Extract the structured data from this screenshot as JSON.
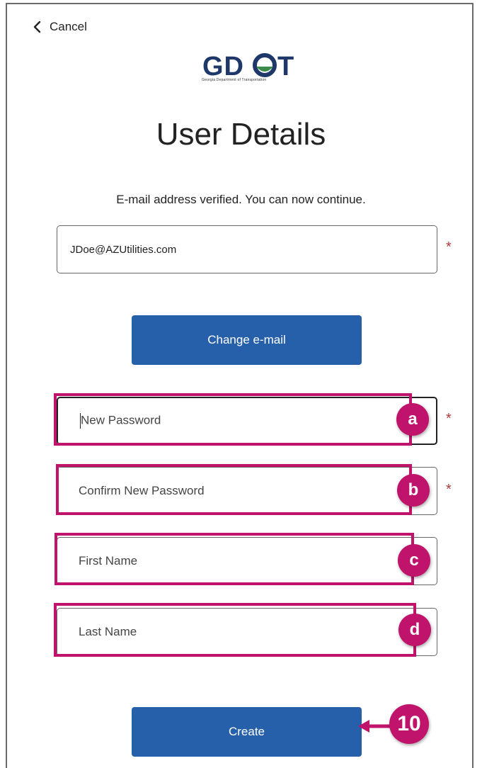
{
  "header": {
    "cancel_label": "Cancel"
  },
  "logo": {
    "text": "GDOT",
    "subtext": "Georgia Department of Transportation"
  },
  "title": "User Details",
  "status_message": "E-mail address verified. You can now continue.",
  "email_field": {
    "value": "JDoe@AZUtilities.com",
    "required_mark": "*"
  },
  "change_email_button": "Change e-mail",
  "fields": {
    "new_password": {
      "placeholder": "New Password",
      "required_mark": "*"
    },
    "confirm_password": {
      "placeholder": "Confirm New Password",
      "required_mark": "*"
    },
    "first_name": {
      "placeholder": "First Name"
    },
    "last_name": {
      "placeholder": "Last Name"
    }
  },
  "create_button": "Create",
  "callouts": {
    "a": "a",
    "b": "b",
    "c": "c",
    "d": "d",
    "step": "10"
  },
  "colors": {
    "accent": "#2660ab",
    "callout": "#c0136b",
    "required": "#b03a3a",
    "logo": "#1e3869"
  }
}
